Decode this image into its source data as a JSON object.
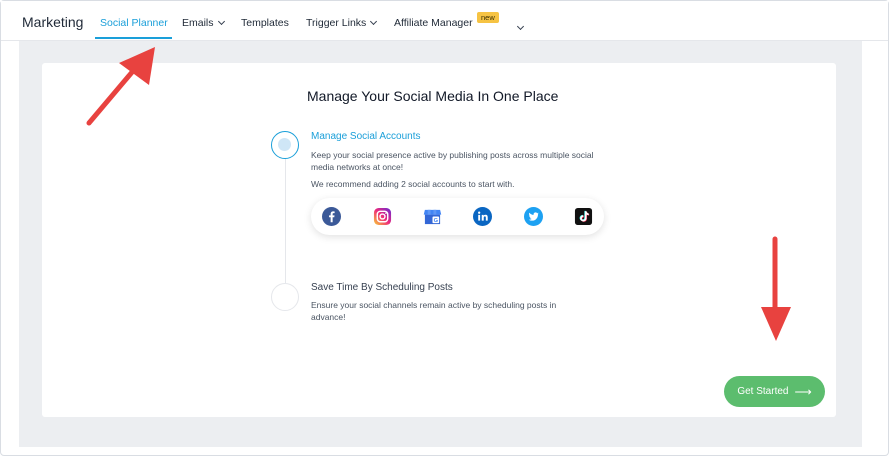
{
  "nav": {
    "brand": "Marketing",
    "items": [
      {
        "label": "Social Planner",
        "active": true
      },
      {
        "label": "Emails",
        "dropdown": true
      },
      {
        "label": "Templates"
      },
      {
        "label": "Trigger Links",
        "dropdown": true
      },
      {
        "label": "Affiliate Manager",
        "badge": "new"
      }
    ],
    "more_icon": "chevron-down-icon"
  },
  "main": {
    "title": "Manage Your Social Media In One Place",
    "steps": [
      {
        "title": "Manage Social Accounts",
        "description": "Keep your social presence active by publishing posts across multiple social media networks at once!",
        "recommendation": "We recommend adding 2 social accounts to start with.",
        "state": "current"
      },
      {
        "title": "Save Time By Scheduling Posts",
        "description": "Ensure your social channels remain active by scheduling posts in advance!",
        "state": "upcoming"
      }
    ],
    "social_networks": [
      "facebook-icon",
      "instagram-icon",
      "google-business-icon",
      "linkedin-icon",
      "twitter-icon",
      "tiktok-icon"
    ],
    "cta_label": "Get Started",
    "cta_icon": "arrow-right-icon"
  },
  "colors": {
    "accent": "#1a9fd9",
    "cta": "#5cbd6e",
    "badge": "#f6c343",
    "annotation_arrow": "#e8423f",
    "facebook": "#3b5998",
    "linkedin": "#0a66c2",
    "twitter": "#1da1f2",
    "tiktok": "#111111"
  }
}
